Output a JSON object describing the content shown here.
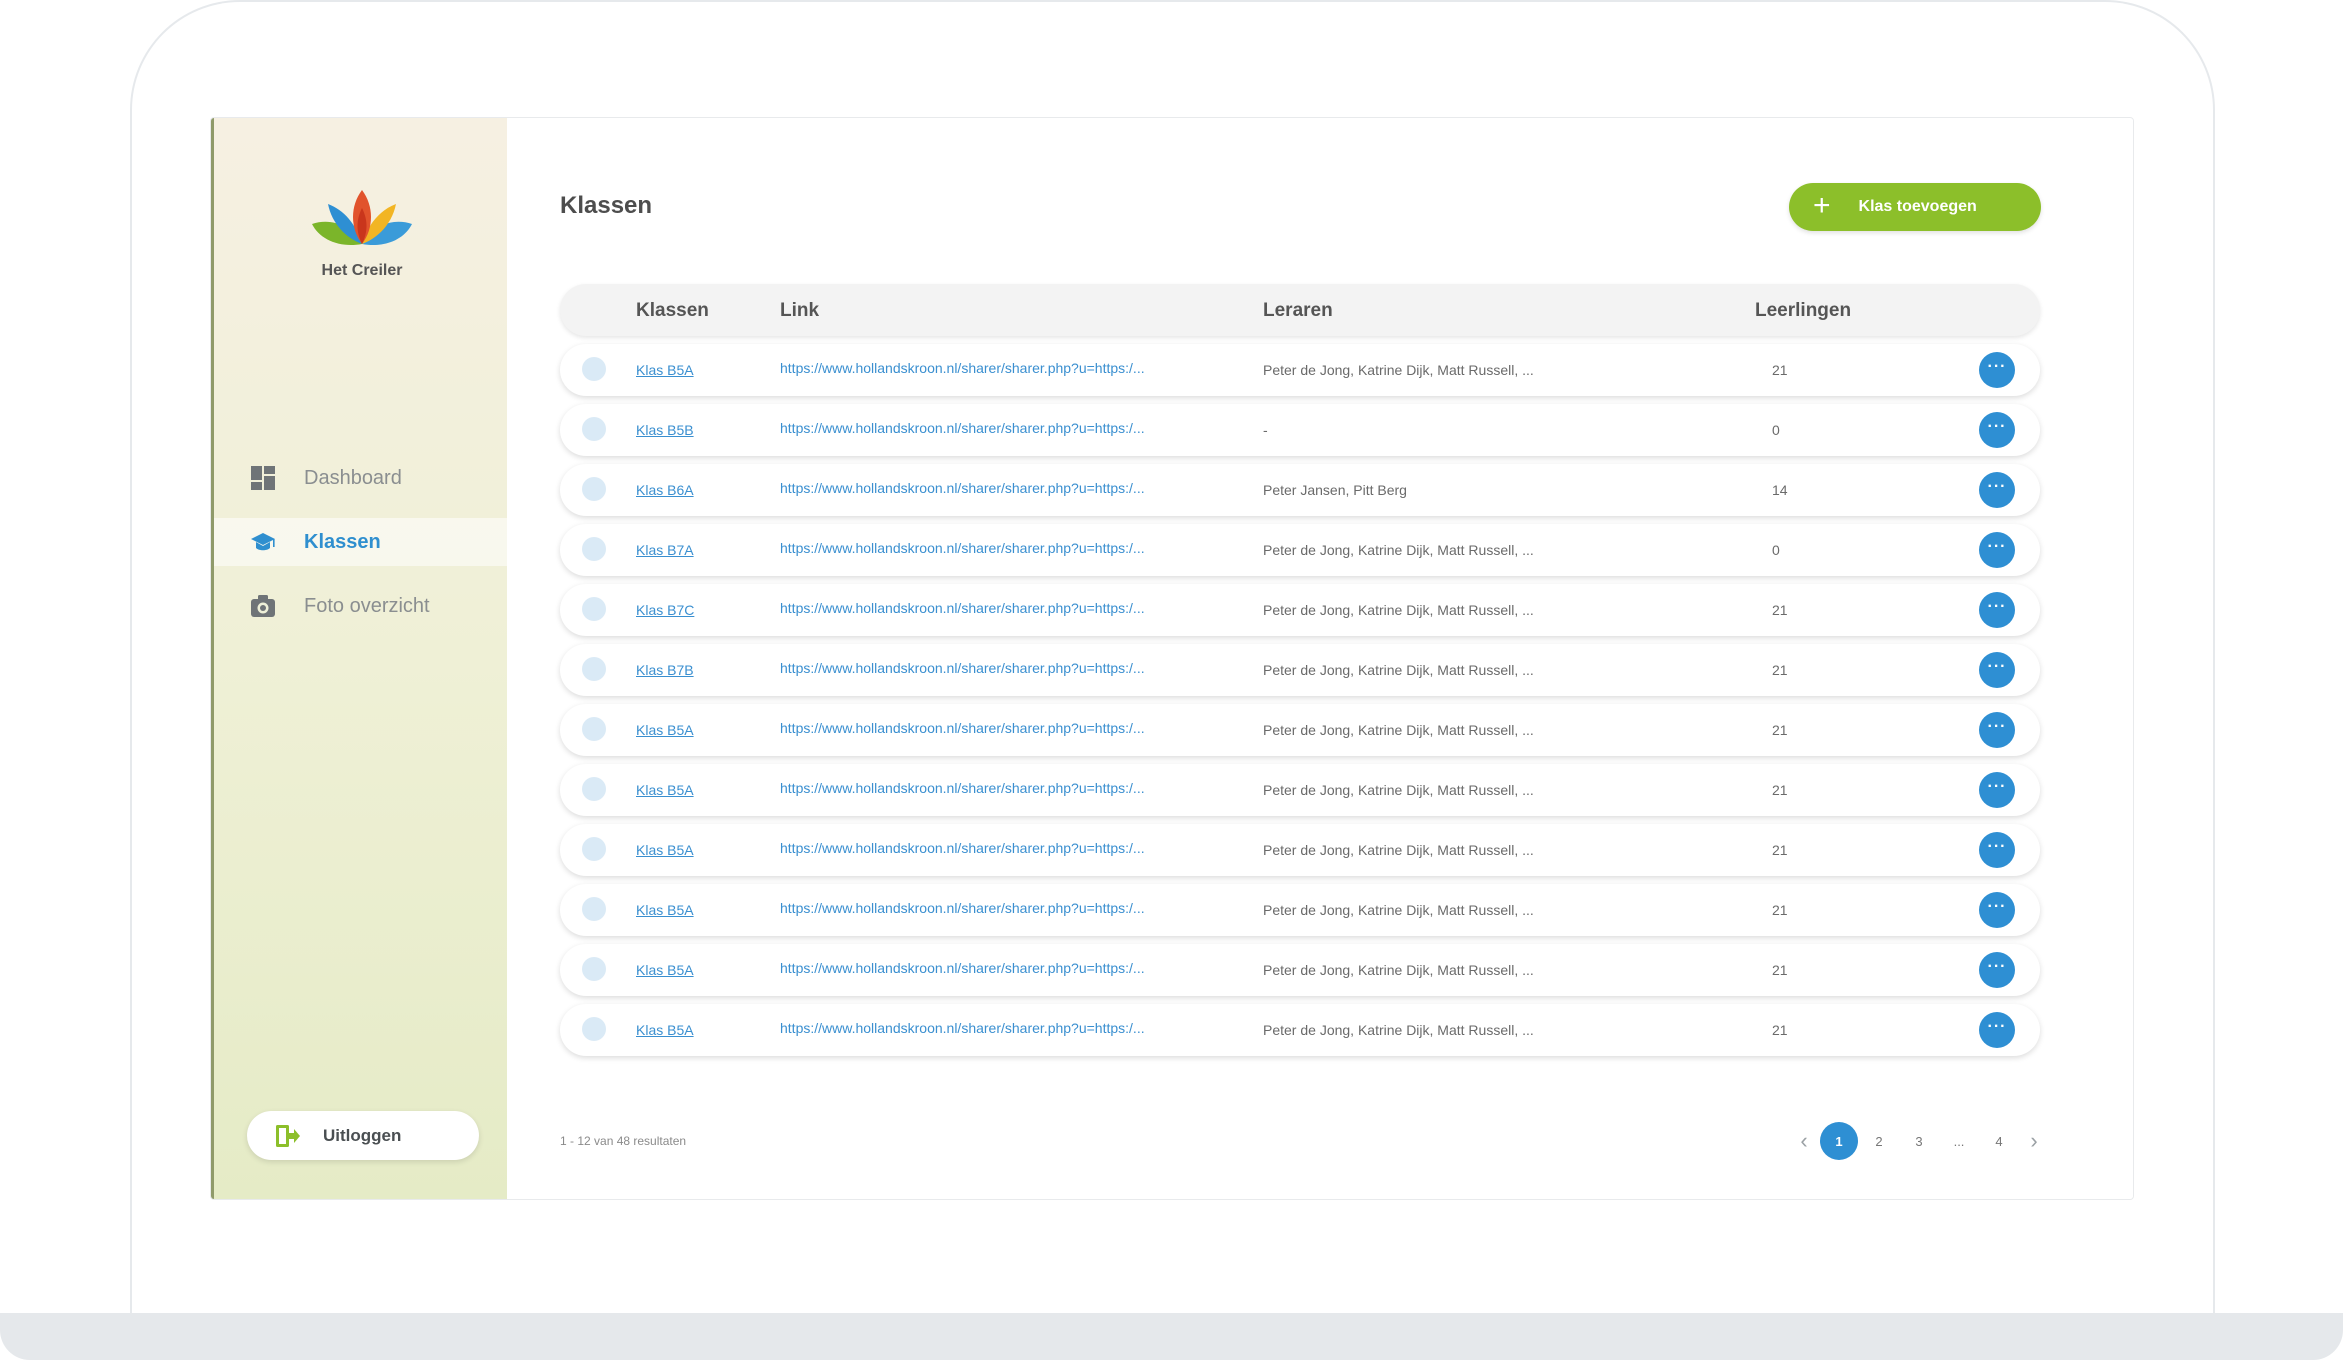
{
  "app": {
    "org_name": "Het Creiler"
  },
  "sidebar": {
    "items": [
      {
        "label": "Dashboard",
        "icon": "dashboard-icon",
        "active": false
      },
      {
        "label": "Klassen",
        "icon": "graduation-cap-icon",
        "active": true
      },
      {
        "label": "Foto overzicht",
        "icon": "camera-icon",
        "active": false
      }
    ],
    "logout_label": "Uitloggen"
  },
  "main": {
    "title": "Klassen",
    "add_button_label": "Klas toevoegen",
    "table": {
      "columns": [
        "Klassen",
        "Link",
        "Leraren",
        "Leerlingen"
      ],
      "rows": [
        {
          "klas": "Klas B5A",
          "link": "https://www.hollandskroon.nl/sharer/sharer.php?u=https:/...",
          "leraren": "Peter de Jong, Katrine Dijk, Matt Russell, ...",
          "leerlingen": "21"
        },
        {
          "klas": "Klas B5B",
          "link": "https://www.hollandskroon.nl/sharer/sharer.php?u=https:/...",
          "leraren": "-",
          "leerlingen": "0"
        },
        {
          "klas": "Klas B6A",
          "link": "https://www.hollandskroon.nl/sharer/sharer.php?u=https:/...",
          "leraren": "Peter Jansen, Pitt Berg",
          "leerlingen": "14"
        },
        {
          "klas": "Klas B7A",
          "link": "https://www.hollandskroon.nl/sharer/sharer.php?u=https:/...",
          "leraren": "Peter de Jong, Katrine Dijk, Matt Russell, ...",
          "leerlingen": "0"
        },
        {
          "klas": "Klas B7C",
          "link": "https://www.hollandskroon.nl/sharer/sharer.php?u=https:/...",
          "leraren": "Peter de Jong, Katrine Dijk, Matt Russell, ...",
          "leerlingen": "21"
        },
        {
          "klas": "Klas B7B",
          "link": "https://www.hollandskroon.nl/sharer/sharer.php?u=https:/...",
          "leraren": "Peter de Jong, Katrine Dijk, Matt Russell, ...",
          "leerlingen": "21"
        },
        {
          "klas": "Klas B5A",
          "link": "https://www.hollandskroon.nl/sharer/sharer.php?u=https:/...",
          "leraren": "Peter de Jong, Katrine Dijk, Matt Russell, ...",
          "leerlingen": "21"
        },
        {
          "klas": "Klas B5A",
          "link": "https://www.hollandskroon.nl/sharer/sharer.php?u=https:/...",
          "leraren": "Peter de Jong, Katrine Dijk, Matt Russell, ...",
          "leerlingen": "21"
        },
        {
          "klas": "Klas B5A",
          "link": "https://www.hollandskroon.nl/sharer/sharer.php?u=https:/...",
          "leraren": "Peter de Jong, Katrine Dijk, Matt Russell, ...",
          "leerlingen": "21"
        },
        {
          "klas": "Klas B5A",
          "link": "https://www.hollandskroon.nl/sharer/sharer.php?u=https:/...",
          "leraren": "Peter de Jong, Katrine Dijk, Matt Russell, ...",
          "leerlingen": "21"
        },
        {
          "klas": "Klas B5A",
          "link": "https://www.hollandskroon.nl/sharer/sharer.php?u=https:/...",
          "leraren": "Peter de Jong, Katrine Dijk, Matt Russell, ...",
          "leerlingen": "21"
        },
        {
          "klas": "Klas B5A",
          "link": "https://www.hollandskroon.nl/sharer/sharer.php?u=https:/...",
          "leraren": "Peter de Jong, Katrine Dijk, Matt Russell, ...",
          "leerlingen": "21"
        }
      ],
      "row_action_label": "···"
    },
    "results_text": "1 - 12 van 48 resultaten",
    "pagination": {
      "prev_label": "‹",
      "next_label": "›",
      "pages": [
        "1",
        "2",
        "3",
        "...",
        "4"
      ],
      "active_page": "1"
    }
  },
  "colors": {
    "accent_blue": "#2e8fd3",
    "accent_green": "#8cbf2a"
  }
}
